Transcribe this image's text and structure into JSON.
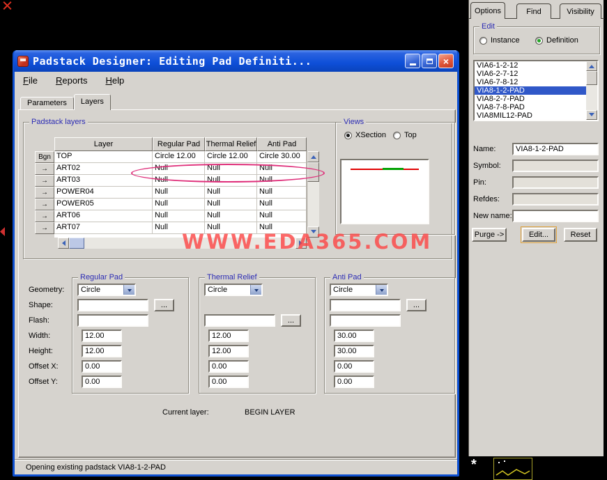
{
  "screen": {
    "watermark": "WWW.EDA365.COM"
  },
  "colors": {
    "titlebar_top": "#5f92f4",
    "titlebar_bottom": "#0a43bb",
    "frame": "#0d4fd0",
    "watermark": "#fc4444",
    "annotation": "#df2f7a",
    "selection": "#3058c8",
    "group_label": "#2b2bb4"
  },
  "dialog": {
    "title": "Padstack Designer: Editing Pad Definiti...",
    "menu": [
      "File",
      "Reports",
      "Help"
    ],
    "tabs": [
      "Parameters",
      "Layers"
    ],
    "layers_group_label": "Padstack layers",
    "table": {
      "headers": [
        "Layer",
        "Regular Pad",
        "Thermal Relief",
        "Anti Pad"
      ],
      "rows": [
        {
          "btn": "Bgn",
          "layer": "TOP",
          "regular_pad": "Circle 12.00",
          "thermal_relief": "Circle 12.00",
          "anti_pad": "Circle 30.00"
        },
        {
          "btn": "→",
          "layer": "ART02",
          "regular_pad": "Null",
          "thermal_relief": "Null",
          "anti_pad": "Null"
        },
        {
          "btn": "→",
          "layer": "ART03",
          "regular_pad": "Null",
          "thermal_relief": "Null",
          "anti_pad": "Null"
        },
        {
          "btn": "→",
          "layer": "POWER04",
          "regular_pad": "Null",
          "thermal_relief": "Null",
          "anti_pad": "Null"
        },
        {
          "btn": "→",
          "layer": "POWER05",
          "regular_pad": "Null",
          "thermal_relief": "Null",
          "anti_pad": "Null"
        },
        {
          "btn": "→",
          "layer": "ART06",
          "regular_pad": "Null",
          "thermal_relief": "Null",
          "anti_pad": "Null"
        },
        {
          "btn": "→",
          "layer": "ART07",
          "regular_pad": "Null",
          "thermal_relief": "Null",
          "anti_pad": "Null"
        }
      ]
    },
    "views": {
      "label": "Views",
      "xsection": "XSection",
      "top": "Top"
    },
    "field_labels": [
      "Geometry:",
      "Shape:",
      "Flash:",
      "Width:",
      "Height:",
      "Offset X:",
      "Offset Y:"
    ],
    "regular_pad": {
      "label": "Regular Pad",
      "geometry": "Circle",
      "shape": "",
      "flash": "",
      "width": "12.00",
      "height": "12.00",
      "offset_x": "0.00",
      "offset_y": "0.00"
    },
    "thermal_relief": {
      "label": "Thermal Relief",
      "geometry": "Circle",
      "flash": "",
      "width": "12.00",
      "height": "12.00",
      "offset_x": "0.00",
      "offset_y": "0.00"
    },
    "anti_pad": {
      "label": "Anti Pad",
      "geometry": "Circle",
      "shape": "",
      "flash": "",
      "width": "30.00",
      "height": "30.00",
      "offset_x": "0.00",
      "offset_y": "0.00"
    },
    "ellipsis_button": "...",
    "current_layer_label": "Current layer:",
    "current_layer_value": "BEGIN LAYER",
    "status": "Opening existing padstack VIA8-1-2-PAD"
  },
  "panel": {
    "tabs": [
      "Options",
      "Find",
      "Visibility"
    ],
    "edit_label": "Edit",
    "radio_instance": "Instance",
    "radio_definition": "Definition",
    "list": [
      "VIA6-1-2-12",
      "VIA6-2-7-12",
      "VIA6-7-8-12",
      "VIA8-1-2-PAD",
      "VIA8-2-7-PAD",
      "VIA8-7-8-PAD",
      "VIA8MIL12-PAD"
    ],
    "fields": [
      {
        "label": "Name:",
        "value": "VIA8-1-2-PAD"
      },
      {
        "label": "Symbol:",
        "value": ""
      },
      {
        "label": "Pin:",
        "value": ""
      },
      {
        "label": "Refdes:",
        "value": ""
      },
      {
        "label": "New name:",
        "value": ""
      }
    ],
    "buttons": [
      "Purge ->",
      "Edit...",
      "Reset"
    ]
  }
}
